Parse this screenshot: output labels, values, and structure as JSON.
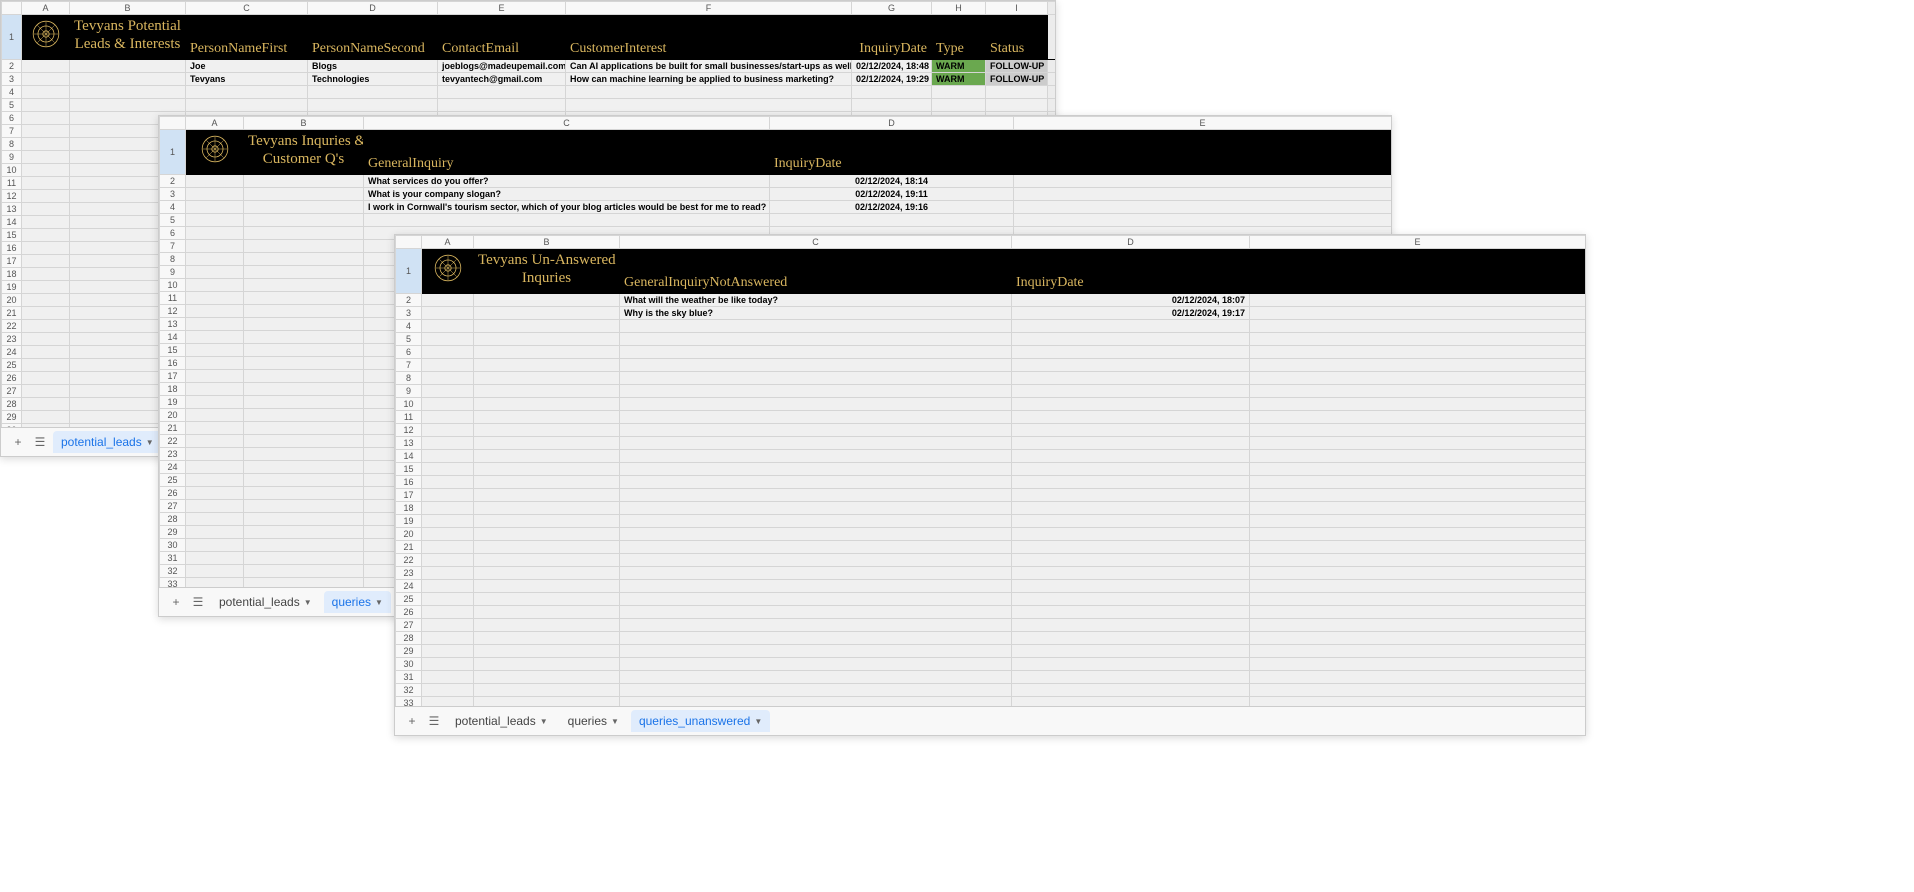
{
  "panel1": {
    "title_line1": "Tevyans Potential",
    "title_line2": "Leads & Interests",
    "cols": [
      "A",
      "B",
      "C",
      "D",
      "E",
      "F",
      "G",
      "H",
      "I"
    ],
    "headers": {
      "C": "PersonNameFirst",
      "D": "PersonNameSecond",
      "E": "ContactEmail",
      "F": "CustomerInterest",
      "G": "InquiryDate",
      "H": "Type",
      "I": "Status"
    },
    "rows": [
      {
        "C": "Joe",
        "D": "Blogs",
        "E": "joeblogs@madeupemail.com",
        "F": "Can AI applications be built for small businesses/start-ups as well?",
        "G": "02/12/2024, 18:48",
        "H": "WARM",
        "I": "FOLLOW-UP"
      },
      {
        "C": "Tevyans",
        "D": "Technologies",
        "E": "tevyantech@gmail.com",
        "F": "How can machine learning be applied to business marketing?",
        "G": "02/12/2024, 19:29",
        "H": "WARM",
        "I": "FOLLOW-UP"
      }
    ],
    "tabs": {
      "potential_leads": "potential_leads"
    }
  },
  "panel2": {
    "title_line1": "Tevyans Inquries &",
    "title_line2": "Customer Q's",
    "cols": [
      "A",
      "B",
      "C",
      "D",
      "E"
    ],
    "headers": {
      "C": "GeneralInquiry",
      "D": "InquiryDate"
    },
    "rows": [
      {
        "C": "What services do you offer?",
        "D": "02/12/2024, 18:14"
      },
      {
        "C": "What is your company slogan?",
        "D": "02/12/2024, 19:11"
      },
      {
        "C": "I work in Cornwall's tourism sector, which of your blog articles would be best for me to read?",
        "D": "02/12/2024, 19:16"
      }
    ],
    "tabs": {
      "potential_leads": "potential_leads",
      "queries": "queries"
    }
  },
  "panel3": {
    "title_line1": "Tevyans Un-Answered",
    "title_line2": "Inquries",
    "cols": [
      "A",
      "B",
      "C",
      "D",
      "E"
    ],
    "headers": {
      "C": "GeneralInquiryNotAnswered",
      "D": "InquiryDate"
    },
    "rows": [
      {
        "C": "What will the weather be like today?",
        "D": "02/12/2024, 18:07"
      },
      {
        "C": "Why is the sky blue?",
        "D": "02/12/2024, 19:17"
      }
    ],
    "tabs": {
      "potential_leads": "potential_leads",
      "queries": "queries",
      "queries_unanswered": "queries_unanswered"
    }
  }
}
